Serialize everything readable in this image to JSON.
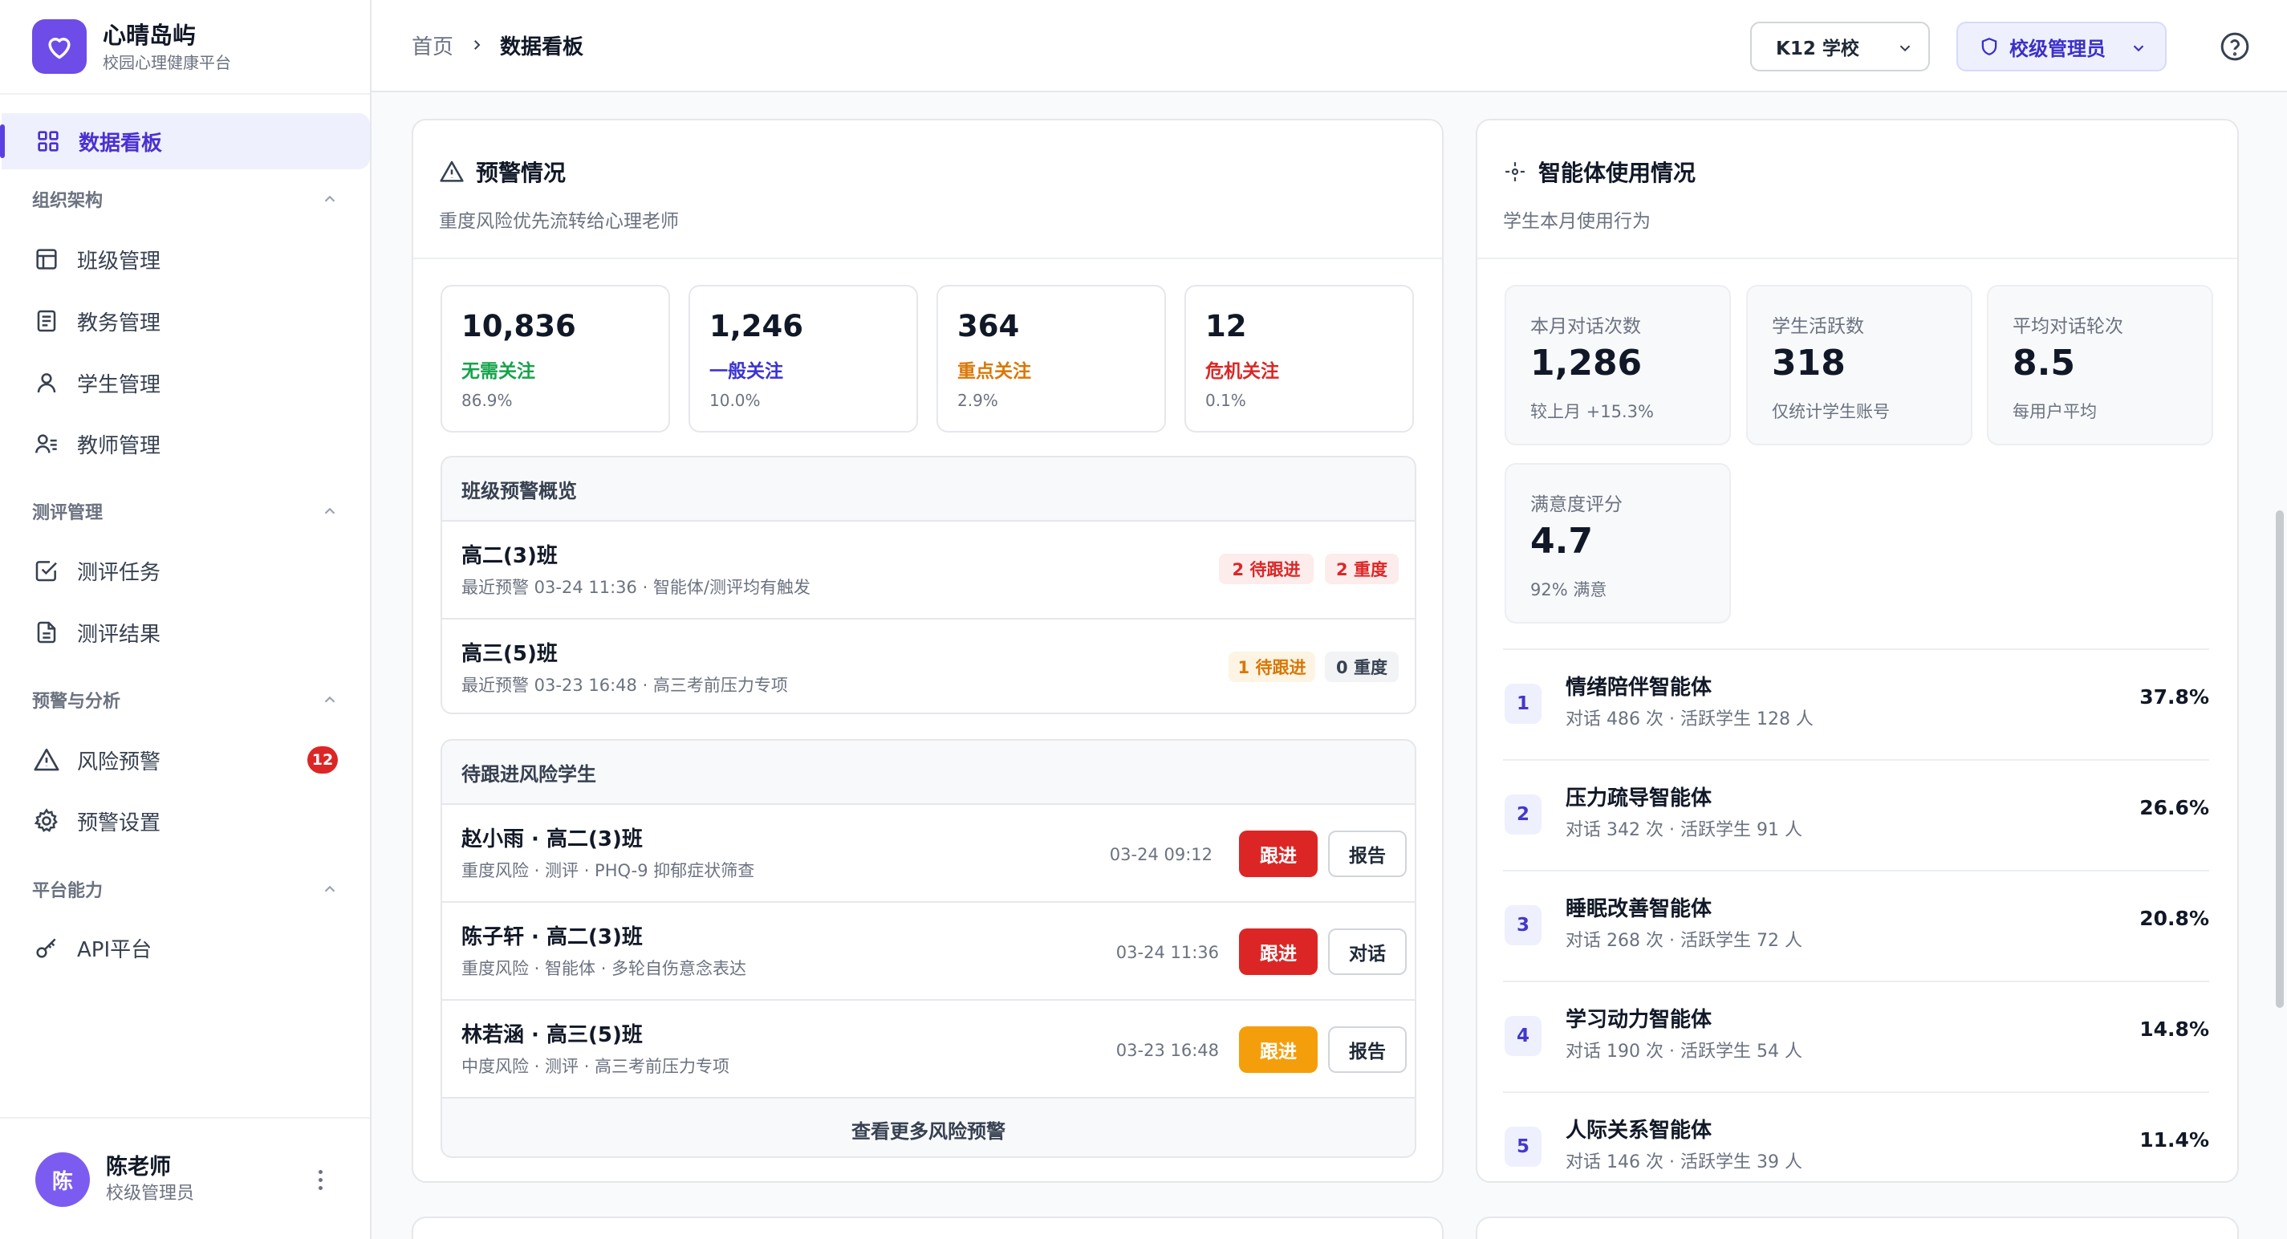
{
  "brand": {
    "name": "心晴岛屿",
    "subtitle": "校园心理健康平台"
  },
  "sidebar": {
    "active": {
      "label": "数据看板",
      "icon": "dashboard-grid-icon"
    },
    "groups": [
      {
        "label": "组织架构",
        "items": [
          {
            "label": "班级管理",
            "icon": "layout-icon"
          },
          {
            "label": "教务管理",
            "icon": "document-list-icon"
          },
          {
            "label": "学生管理",
            "icon": "user-icon"
          },
          {
            "label": "教师管理",
            "icon": "user-list-icon"
          }
        ]
      },
      {
        "label": "测评管理",
        "items": [
          {
            "label": "测评任务",
            "icon": "checkbox-icon"
          },
          {
            "label": "测评结果",
            "icon": "file-text-icon"
          }
        ]
      },
      {
        "label": "预警与分析",
        "items": [
          {
            "label": "风险预警",
            "icon": "warning-triangle-icon",
            "badge": "12"
          },
          {
            "label": "预警设置",
            "icon": "gear-icon"
          }
        ]
      },
      {
        "label": "平台能力",
        "items": [
          {
            "label": "API平台",
            "icon": "key-icon"
          }
        ]
      }
    ]
  },
  "user": {
    "avatar": "陈",
    "name": "陈老师",
    "role": "校级管理员"
  },
  "header": {
    "breadcrumb": {
      "home": "首页",
      "current": "数据看板"
    },
    "school_select": "K12 学校",
    "role_button": "校级管理员"
  },
  "warning_card": {
    "title": "预警情况",
    "subtitle": "重度风险优先流转给心理老师",
    "stats": [
      {
        "value": "10,836",
        "label": "无需关注",
        "pct": "86.9%",
        "color": "#15a34a"
      },
      {
        "value": "1,246",
        "label": "一般关注",
        "pct": "10.0%",
        "color": "#3b32d4"
      },
      {
        "value": "364",
        "label": "重点关注",
        "pct": "2.9%",
        "color": "#d97706"
      },
      {
        "value": "12",
        "label": "危机关注",
        "pct": "0.1%",
        "color": "#dc2626"
      }
    ],
    "class_overview": {
      "title": "班级预警概览",
      "rows": [
        {
          "name": "高二(3)班",
          "sub": "最近预警 03-24 11:36 · 智能体/测评均有触发",
          "tag1": "2 待跟进",
          "tag2": "2 重度"
        },
        {
          "name": "高三(5)班",
          "sub": "最近预警 03-23 16:48 · 高三考前压力专项",
          "tag1": "1 待跟进",
          "tag2": "0 重度"
        }
      ]
    },
    "risk_students": {
      "title": "待跟进风险学生",
      "rows": [
        {
          "name": "赵小雨 · 高二(3)班",
          "sub": "重度风险 · 测评 · PHQ-9 抑郁症状筛查",
          "time": "03-24 09:12",
          "primary": "跟进",
          "secondary": "报告"
        },
        {
          "name": "陈子轩 · 高二(3)班",
          "sub": "重度风险 · 智能体 · 多轮自伤意念表达",
          "time": "03-24 11:36",
          "primary": "跟进",
          "secondary": "对话"
        },
        {
          "name": "林若涵 · 高三(5)班",
          "sub": "中度风险 · 测评 · 高三考前压力专项",
          "time": "03-23 16:48",
          "primary": "跟进",
          "secondary": "报告"
        }
      ],
      "more": "查看更多风险预警"
    }
  },
  "agent_card": {
    "title": "智能体使用情况",
    "subtitle": "学生本月使用行为",
    "metrics": [
      {
        "label": "本月对话次数",
        "value": "1,286",
        "note": "较上月 +15.3%"
      },
      {
        "label": "学生活跃数",
        "value": "318",
        "note": "仅统计学生账号"
      },
      {
        "label": "平均对话轮次",
        "value": "8.5",
        "note": "每用户平均"
      },
      {
        "label": "满意度评分",
        "value": "4.7",
        "note": "92% 满意"
      }
    ],
    "agents": [
      {
        "rank": "1",
        "name": "情绪陪伴智能体",
        "sub": "对话 486 次 · 活跃学生 128 人",
        "pct": "37.8%"
      },
      {
        "rank": "2",
        "name": "压力疏导智能体",
        "sub": "对话 342 次 · 活跃学生 91 人",
        "pct": "26.6%"
      },
      {
        "rank": "3",
        "name": "睡眠改善智能体",
        "sub": "对话 268 次 · 活跃学生 72 人",
        "pct": "20.8%"
      },
      {
        "rank": "4",
        "name": "学习动力智能体",
        "sub": "对话 190 次 · 活跃学生 54 人",
        "pct": "14.8%"
      },
      {
        "rank": "5",
        "name": "人际关系智能体",
        "sub": "对话 146 次 · 活跃学生 39 人",
        "pct": "11.4%"
      }
    ]
  },
  "colors": {
    "accent": "#5b3fe0",
    "danger": "#dc2626",
    "warning": "#f59e0b"
  }
}
